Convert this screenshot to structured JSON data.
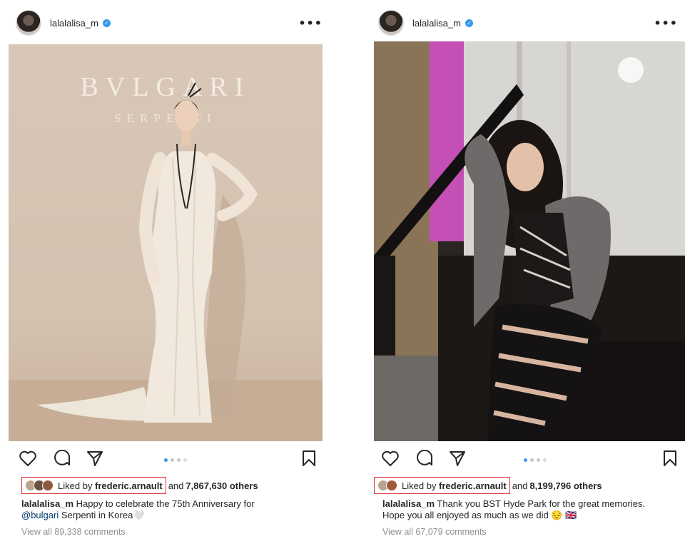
{
  "posts": [
    {
      "username": "lalalalisa_m",
      "photo": {
        "brand_text": "BVLGARI",
        "sub_text": "SERPENTI"
      },
      "carousel": {
        "count": 4,
        "active_index": 0
      },
      "likes": {
        "liked_by_label": "Liked by",
        "liked_by_user": "frederic.arnault",
        "and_label": "and",
        "count_text": "7,867,630 others"
      },
      "caption": {
        "user": "lalalalisa_m",
        "text_before": "Happy to celebrate the 75th Anniversary for",
        "mention": "@bulgari",
        "text_after": "Serpenti in Korea",
        "emoji": "🤍"
      },
      "view_comments": "View all 89,338 comments"
    },
    {
      "username": "lalalalisa_m",
      "carousel": {
        "count": 4,
        "active_index": 0
      },
      "likes": {
        "liked_by_label": "Liked by",
        "liked_by_user": "frederic.arnault",
        "and_label": "and",
        "count_text": "8,199,796 others"
      },
      "caption": {
        "user": "lalalalisa_m",
        "text_line1": "Thank you BST Hyde Park for the great memories.",
        "text_line2": "Hope you all enjoyed as much as we did",
        "emoji": "😔 🇬🇧"
      },
      "view_comments": "View all 67,079 comments"
    }
  ],
  "icons": {
    "verified": "verified-badge",
    "more": "more-options",
    "like": "heart",
    "comment": "speech-bubble",
    "share": "paper-plane",
    "save": "bookmark"
  },
  "colors": {
    "verified_blue": "#3897f0",
    "highlight_red": "#d9333a",
    "muted_text": "#8e8e8e",
    "mention_blue": "#00376b"
  }
}
